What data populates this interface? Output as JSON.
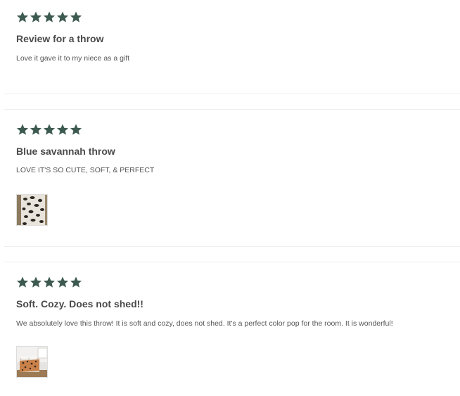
{
  "theme": {
    "star_color": "#3d5a50"
  },
  "reviews": [
    {
      "rating": 5,
      "title": "Review for a throw",
      "body": "Love it gave it to my niece as a gift",
      "photo": null
    },
    {
      "rating": 5,
      "title": "Blue savannah throw",
      "body": "LOVE IT'S SO CUTE, SOFT, & PERFECT",
      "photo": "leopard-throw-photo"
    },
    {
      "rating": 5,
      "title": "Soft. Cozy. Does not shed!!",
      "body": "We absolutely love this throw! It is soft and cozy, does not shed. It's a perfect color pop for the room. It is wonderful!",
      "photo": "bedroom-throw-photo"
    }
  ]
}
